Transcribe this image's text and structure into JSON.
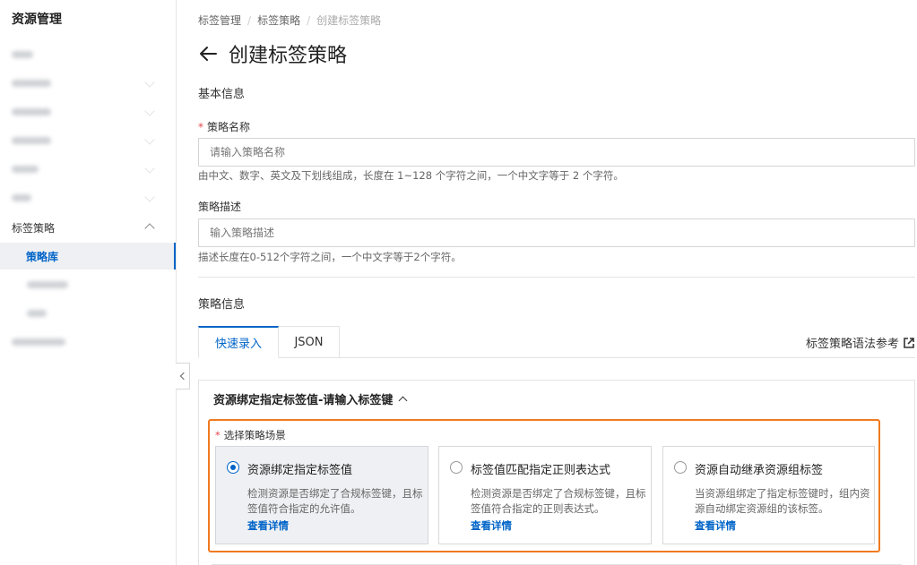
{
  "sidebar": {
    "title": "资源管理",
    "blurred_items": [
      {
        "width": 24,
        "has_chevron": false
      },
      {
        "width": 44,
        "has_chevron": true
      },
      {
        "width": 44,
        "has_chevron": true
      },
      {
        "width": 44,
        "has_chevron": true
      },
      {
        "width": 30,
        "has_chevron": true
      },
      {
        "width": 22,
        "has_chevron": true
      }
    ],
    "tag_policy_label": "标签策略",
    "policy_library_label": "策略库",
    "sub_blurred": [
      {
        "width": 46
      },
      {
        "width": 22
      }
    ],
    "last_blurred": {
      "width": 60
    }
  },
  "breadcrumb": {
    "items": [
      "标签管理",
      "标签策略",
      "创建标签策略"
    ],
    "separator": "/"
  },
  "page": {
    "title": "创建标签策略",
    "back_icon": "arrow-left-icon"
  },
  "basic_info": {
    "section_title": "基本信息",
    "name_label": "策略名称",
    "name_placeholder": "请输入策略名称",
    "name_hint": "由中文、数字、英文及下划线组成，长度在 1~128 个字符之间，一个中文字等于 2 个字符。",
    "desc_label": "策略描述",
    "desc_placeholder": "输入策略描述",
    "desc_hint": "描述长度在0-512个字符之间，一个中文字等于2个字符。"
  },
  "policy_info": {
    "section_title": "策略信息",
    "tabs": [
      {
        "label": "快速录入",
        "active": true
      },
      {
        "label": "JSON",
        "active": false
      }
    ],
    "syntax_link": "标签策略语法参考",
    "panel_title": "资源绑定指定标签值-请输入标签键",
    "scene_label": "选择策略场景",
    "cards": [
      {
        "title": "资源绑定指定标签值",
        "desc": "检测资源是否绑定了合规标签键，且标签值符合指定的允许值。",
        "link": "查看详情",
        "selected": true
      },
      {
        "title": "标签值匹配指定正则表达式",
        "desc": "检测资源是否绑定了合规标签键，且标签值符合指定的正则表达式。",
        "link": "查看详情",
        "selected": false
      },
      {
        "title": "资源自动继承资源组标签",
        "desc": "当资源组绑定了指定标签键时，组内资源自动绑定资源组的该标签。",
        "link": "查看详情",
        "selected": false
      }
    ]
  },
  "colors": {
    "accent": "#0064c8",
    "highlight": "#f07a1f",
    "required": "#e5484d"
  }
}
